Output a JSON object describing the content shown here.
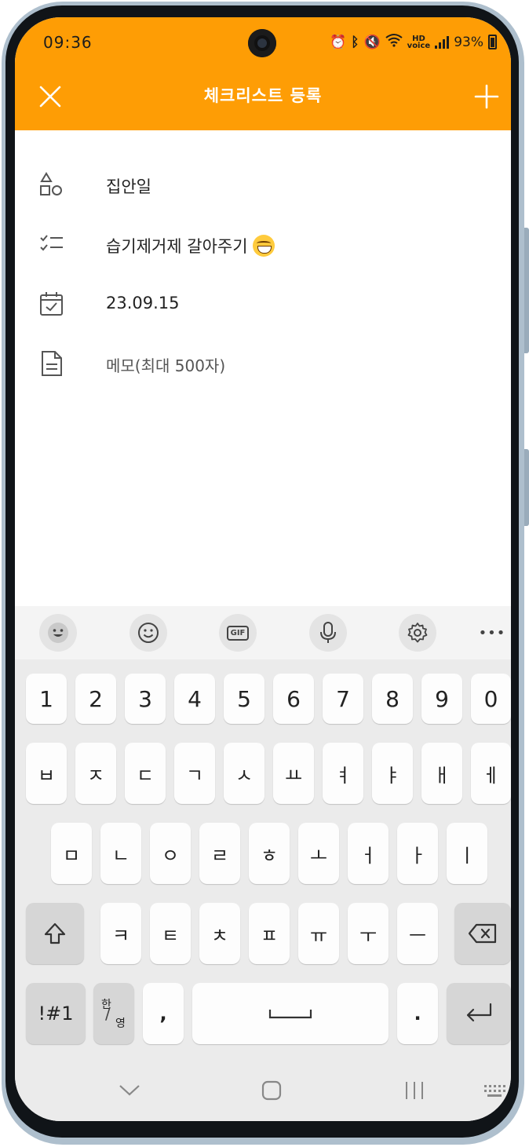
{
  "status_bar": {
    "time": "09:36",
    "battery": "93%",
    "icons": [
      "alarm-icon",
      "bluetooth-icon",
      "vibrate-icon",
      "wifi-icon",
      "hd-voice-icon",
      "signal-icon",
      "battery-icon"
    ]
  },
  "header": {
    "title": "체크리스트 등록",
    "close_icon": "close-icon",
    "add_icon": "plus-icon",
    "color": "#fe9d05"
  },
  "form": {
    "category": "집안일",
    "task": "습기제거제 갈아주기",
    "task_emoji": "sweat-smile-emoji",
    "date": "23.09.15",
    "memo_placeholder": "메모(최대 500자)"
  },
  "keyboard": {
    "toolbar": [
      "emoji-icon",
      "smiley-icon",
      "gif-icon",
      "mic-icon",
      "settings-icon",
      "more-icon"
    ],
    "gif_label": "GIF",
    "more_label": "•••",
    "numbers": [
      "1",
      "2",
      "3",
      "4",
      "5",
      "6",
      "7",
      "8",
      "9",
      "0"
    ],
    "row1": [
      "ㅂ",
      "ㅈ",
      "ㄷ",
      "ㄱ",
      "ㅅ",
      "ㅛ",
      "ㅕ",
      "ㅑ",
      "ㅐ",
      "ㅔ"
    ],
    "row2": [
      "ㅁ",
      "ㄴ",
      "ㅇ",
      "ㄹ",
      "ㅎ",
      "ㅗ",
      "ㅓ",
      "ㅏ",
      "ㅣ"
    ],
    "row3": [
      "ㅋ",
      "ㅌ",
      "ㅊ",
      "ㅍ",
      "ㅠ",
      "ㅜ",
      "ㅡ"
    ],
    "symbols_label": "!#1",
    "lang_top": "한",
    "lang_bottom": "영",
    "comma": ",",
    "period": "."
  },
  "navbar": {
    "icons": [
      "chevron-down-icon",
      "home-icon",
      "recents-icon",
      "keyboard-icon"
    ]
  }
}
